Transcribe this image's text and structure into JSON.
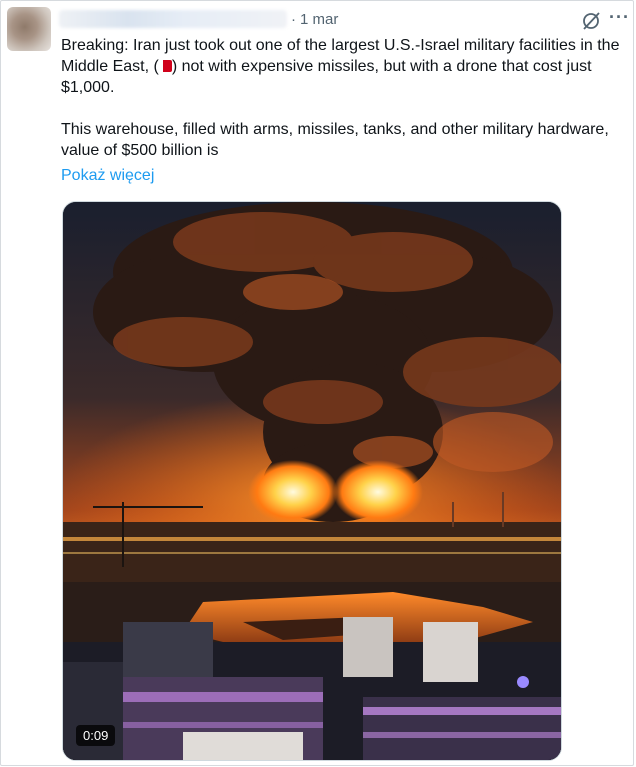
{
  "post": {
    "date": "1 mar",
    "separator": "·",
    "more_icon": "ellipsis-icon",
    "grok_icon": "grok-icon",
    "text_line1_before_flag": "Breaking: Iran just took out one of the largest U.S.-Israel military facilities in the Middle East, (",
    "text_line1_after_flag": ") not with expensive missiles, but with a drone that cost just $1,000.",
    "text_para2": "This warehouse, filled with arms, missiles, tanks, and other military hardware, value of $500 billion is",
    "show_more": "Pokaż więcej",
    "video": {
      "duration": "0:09"
    }
  },
  "colors": {
    "accent": "#1d9bf0",
    "text": "#0f1419",
    "muted": "#536471",
    "flag_red": "#d0011b"
  }
}
